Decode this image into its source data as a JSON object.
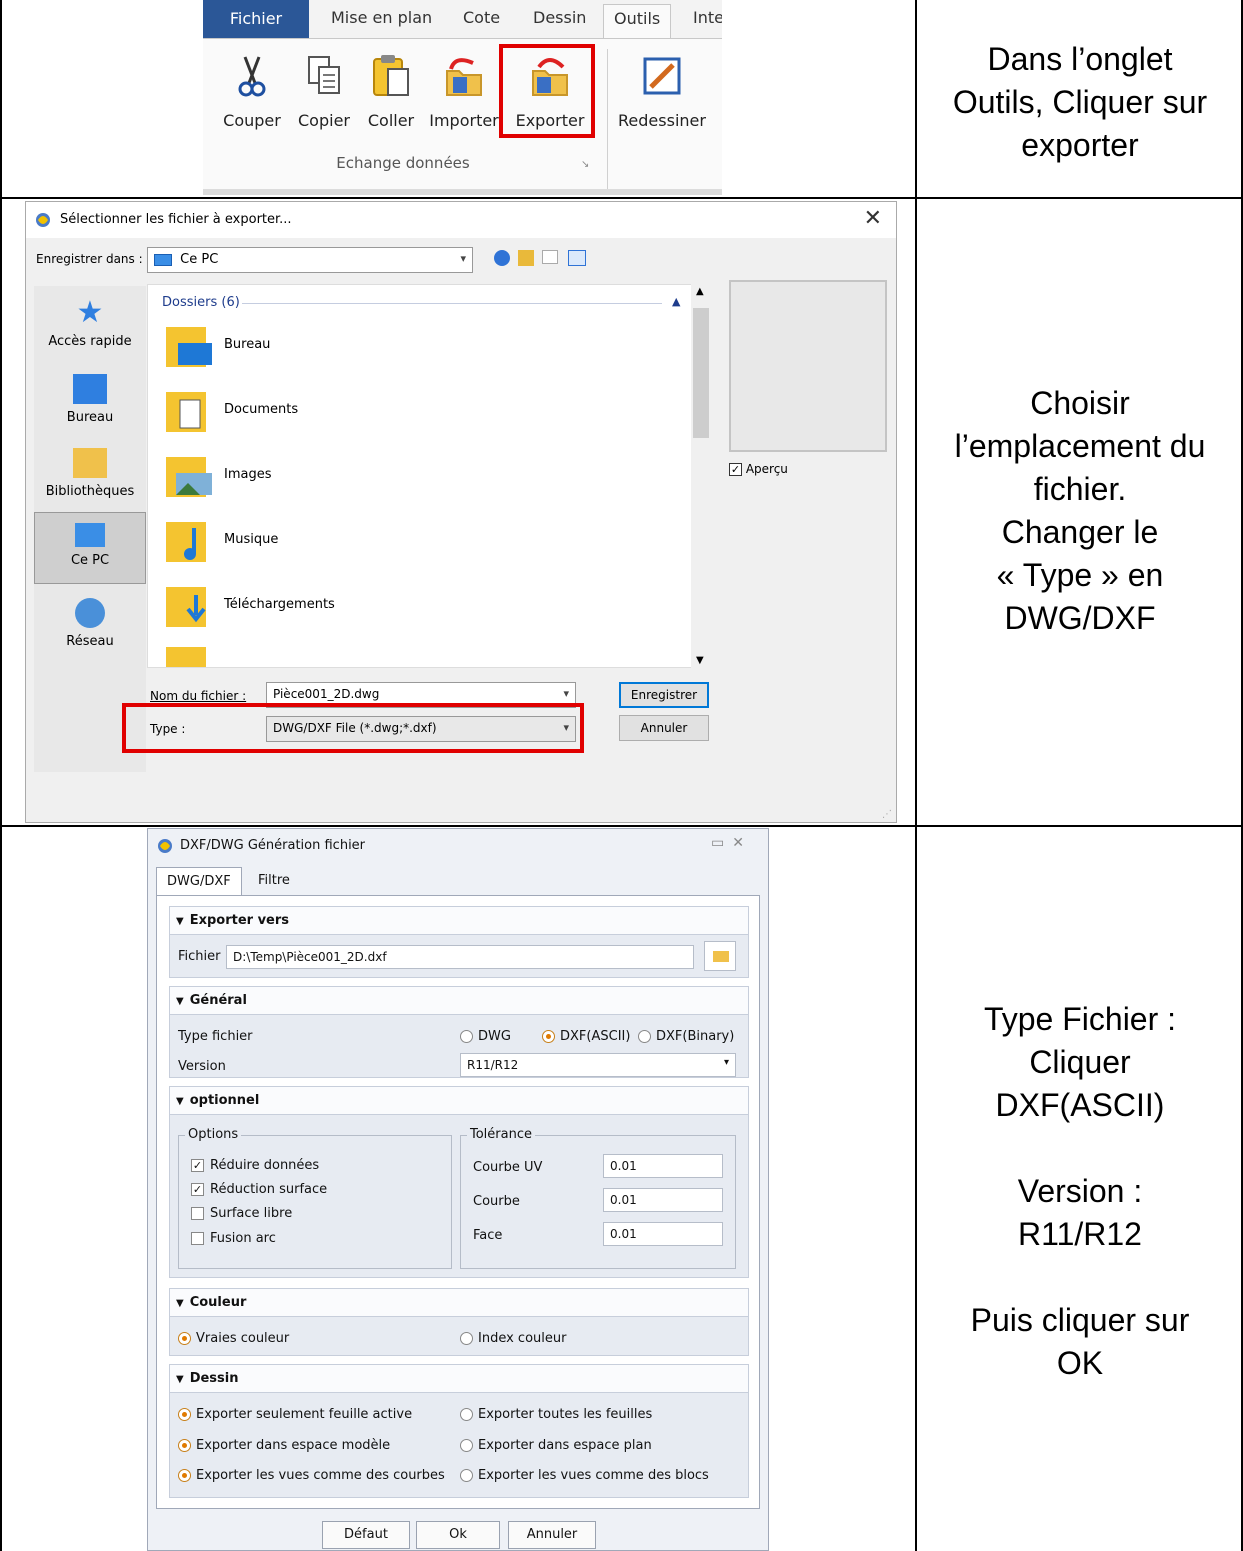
{
  "instructions": {
    "step1": "Dans l’onglet\nOutils, Cliquer sur\nexporter",
    "step2": "Choisir\nl’emplacement du\nfichier.\nChanger le\n« Type » en\nDWG/DXF",
    "step3": "Type Fichier :\nCliquer\nDXF(ASCII)\n\nVersion :\nR11/R12\n\nPuis cliquer sur\nOK"
  },
  "ribbon": {
    "tabs": [
      "Fichier",
      "Mise en plan",
      "Cote",
      "Dessin",
      "Outils",
      "Inte"
    ],
    "buttons": [
      "Couper",
      "Copier",
      "Coller",
      "Importer",
      "Exporter",
      "Redessiner"
    ],
    "group_label": "Echange données"
  },
  "save_dialog": {
    "title": "Sélectionner les fichier à exporter...",
    "close_glyph": "✕",
    "save_in_label": "Enregistrer dans :",
    "location": "Ce PC",
    "places": [
      "Accès rapide",
      "Bureau",
      "Bibliothèques",
      "Ce PC",
      "Réseau"
    ],
    "group_header": "Dossiers (6)",
    "folders": [
      "Bureau",
      "Documents",
      "Images",
      "Musique",
      "Téléchargements"
    ],
    "preview_label": "Aperçu",
    "filename_label": "Nom du fichier :",
    "filename": "Pièce001_2D.dwg",
    "type_label": "Type :",
    "type_value": "DWG/DXF File (*.dwg;*.dxf)",
    "save_button": "Enregistrer",
    "cancel_button": "Annuler"
  },
  "dxf_dialog": {
    "title": "DXF/DWG Génération fichier",
    "tabs": [
      "DWG/DXF",
      "Filtre"
    ],
    "export_section": "Exporter vers",
    "file_label": "Fichier",
    "file_path": "D:\\Temp\\Pièce001_2D.dxf",
    "general_section": "Général",
    "file_type_label": "Type fichier",
    "file_type_options": [
      "DWG",
      "DXF(ASCII)",
      "DXF(Binary)"
    ],
    "version_label": "Version",
    "version_value": "R11/R12",
    "optional_section": "optionnel",
    "options_group": "Options",
    "options": [
      "Réduire données",
      "Réduction surface",
      "Surface libre",
      "Fusion arc"
    ],
    "tolerance_group": "Tolérance",
    "tolerances": [
      {
        "label": "Courbe UV",
        "value": "0.01"
      },
      {
        "label": "Courbe",
        "value": "0.01"
      },
      {
        "label": "Face",
        "value": "0.01"
      }
    ],
    "color_section": "Couleur",
    "color_options": [
      "Vraies couleur",
      "Index couleur"
    ],
    "drawing_section": "Dessin",
    "drawing_options_left": [
      "Exporter seulement feuille active",
      "Exporter dans espace modèle",
      "Exporter les vues comme des courbes"
    ],
    "drawing_options_right": [
      "Exporter toutes les feuilles",
      "Exporter dans espace plan",
      "Exporter les vues comme des blocs"
    ],
    "buttons": [
      "Défaut",
      "Ok",
      "Annuler"
    ]
  }
}
